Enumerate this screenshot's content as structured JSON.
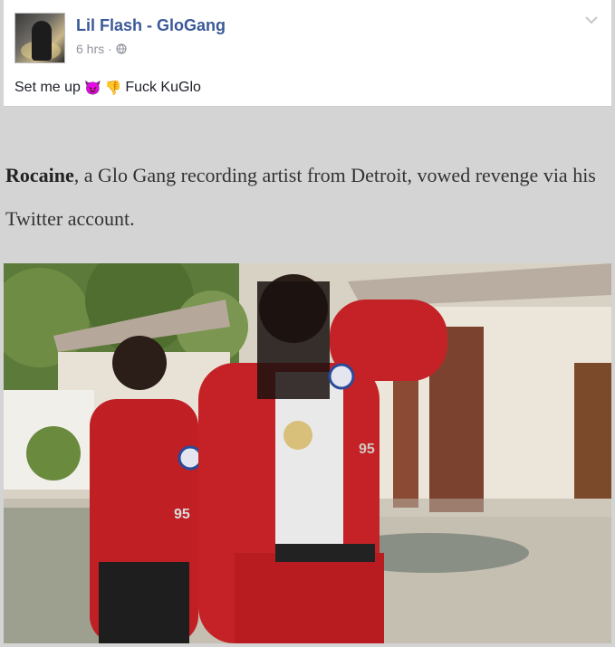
{
  "post": {
    "author": "Lil Flash - GloGang",
    "time": "6 hrs",
    "separator": "·",
    "privacy_icon": "globe-icon",
    "menu_icon": "chevron-down-icon",
    "text_before": "Set me up",
    "emojis": [
      "😈",
      "👎"
    ],
    "text_after": "Fuck KuGlo"
  },
  "article": {
    "name": "Rocaine",
    "sentence": ", a Glo Gang recording artist from Detroit, vowed revenge via his Twitter account."
  },
  "photo": {
    "patch_left": "95",
    "patch_right": "95",
    "colors": {
      "jacket_red": "#c01f24",
      "link_blue": "#3b5998"
    }
  }
}
